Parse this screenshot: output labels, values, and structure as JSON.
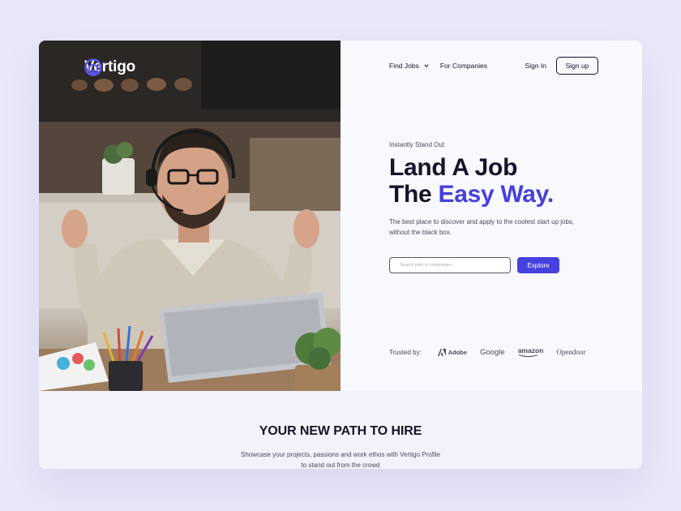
{
  "brand": {
    "name": "Vertigo",
    "logo_icon": "vertigo-swirl-icon"
  },
  "nav": {
    "find_jobs": "Find Jobs",
    "for_companies": "For Companies",
    "sign_in": "Sign In",
    "sign_up": "Sign up"
  },
  "hero": {
    "eyebrow": "Instantly Stand Out",
    "headline_line1": "Land A Job",
    "headline_line2_prefix": "The ",
    "headline_line2_accent": "Easy Way.",
    "description_line1": "The best place to discover and apply to the coolest start up jobs,",
    "description_line2": "without the black box.",
    "search_placeholder": "Search jobs or companies ...",
    "explore_button": "Explore",
    "image_alt": "smiling man with headset at laptop"
  },
  "trusted": {
    "label": "Trusted by:",
    "brands": [
      "Adobe",
      "Google",
      "amazon",
      "Opendoor"
    ]
  },
  "section": {
    "title": "YOUR NEW PATH TO HIRE",
    "description_line1": "Showcase your projects, passions and work ethos with Vertigo Profile",
    "description_line2": "to  stand out from the crowd"
  },
  "colors": {
    "accent": "#4640de",
    "page_bg": "#e9e8f8",
    "text_dark": "#14142b"
  }
}
